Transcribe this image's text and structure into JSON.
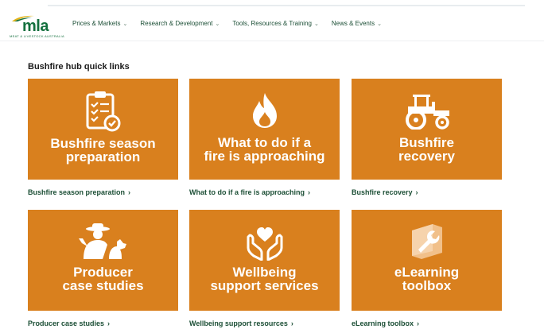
{
  "header": {
    "logo_text": "mla",
    "tagline": "MEAT & LIVESTOCK AUSTRALIA",
    "nav": [
      {
        "label": "Prices & Markets"
      },
      {
        "label": "Research & Development"
      },
      {
        "label": "Tools, Resources & Training"
      },
      {
        "label": "News & Events"
      }
    ]
  },
  "section": {
    "title": "Bushfire hub quick links"
  },
  "tiles": [
    {
      "title": "Bushfire season\npreparation",
      "link": "Bushfire season preparation",
      "icon": "clipboard-check-icon"
    },
    {
      "title": "What to do if a\nfire is approaching",
      "link": "What to do if a fire is approaching",
      "icon": "flame-icon"
    },
    {
      "title": "Bushfire\nrecovery",
      "link": "Bushfire recovery",
      "icon": "tractor-icon"
    },
    {
      "title": "Producer\ncase studies",
      "link": "Producer case studies",
      "icon": "farmer-dog-icon"
    },
    {
      "title": "Wellbeing\nsupport services",
      "link": "Wellbeing support resources",
      "icon": "hands-heart-icon"
    },
    {
      "title": "eLearning\ntoolbox",
      "link": "eLearning toolbox",
      "icon": "wrench-icon"
    }
  ],
  "colors": {
    "tile": "#d9801e",
    "brand_green": "#14703e",
    "link_green": "#1c4f36"
  }
}
